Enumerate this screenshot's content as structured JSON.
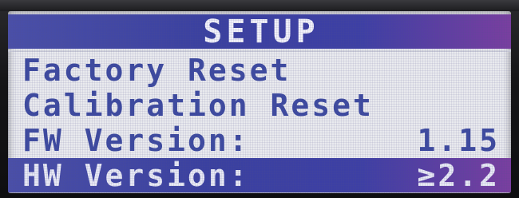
{
  "screen": {
    "title": "SETUP",
    "items": [
      {
        "label": "Factory Reset",
        "value": ""
      },
      {
        "label": "Calibration Reset",
        "value": ""
      },
      {
        "label": "FW Version:",
        "value": "1.15"
      },
      {
        "label": "HW Version:",
        "value": "≥2.2",
        "selected": true
      }
    ]
  },
  "colors": {
    "text": "#3d4aa0",
    "highlight": "#3a40a0",
    "screen_bg": "#e9eaee"
  }
}
